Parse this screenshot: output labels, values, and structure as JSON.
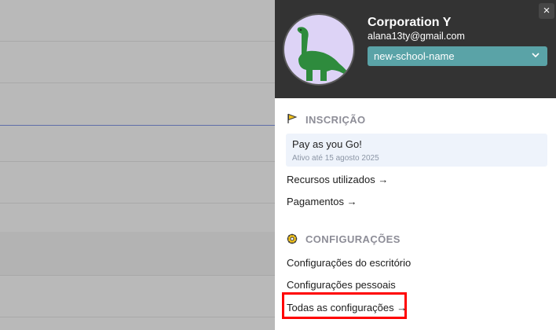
{
  "account": {
    "org_name": "Corporation Y",
    "email": "alana13ty@gmail.com",
    "school_select_value": "new-school-name",
    "close_label": "×"
  },
  "subscription": {
    "title": "INSCRIÇÃO",
    "plan_name": "Pay as you Go!",
    "plan_status": "Ativo até 15 agosto 2025",
    "links": [
      "Recursos utilizados →",
      "Pagamentos →"
    ]
  },
  "settings": {
    "title": "CONFIGURAÇÕES",
    "links": [
      "Configurações do escritório",
      "Configurações pessoais",
      "Todas as configurações →"
    ]
  },
  "colors": {
    "header_bg": "#333333",
    "select_bg": "#5aa3a7",
    "avatar_bg": "#ddd3f6",
    "highlight": "#ff0000",
    "flag_icon": "#f2c21b",
    "gear_icon": "#f2c21b"
  },
  "icons": {
    "avatar": "dinosaur-avatar",
    "subscription": "flag-icon",
    "settings": "gear-icon",
    "select": "chevron-down-icon",
    "close": "close-icon"
  }
}
